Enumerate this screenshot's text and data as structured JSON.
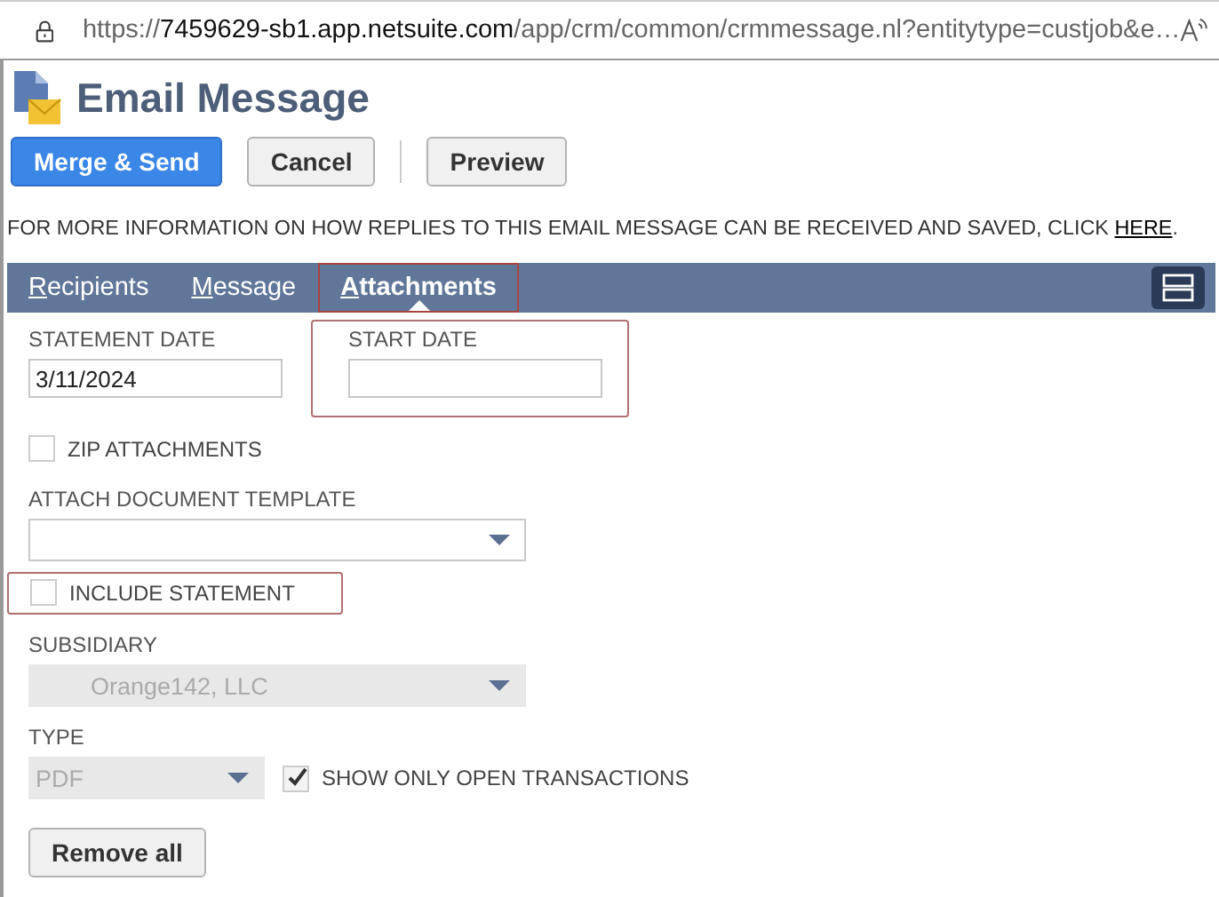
{
  "address_bar": {
    "scheme": "https://",
    "host": "7459629-sb1.app.netsuite.com",
    "path": "/app/crm/common/crmmessage.nl?entitytype=custjob&e…"
  },
  "title": "Email Message",
  "buttons": [
    {
      "label": "Merge & Send",
      "kind": "primary"
    },
    {
      "label": "Cancel",
      "kind": "secondary"
    },
    {
      "label": "Preview",
      "kind": "secondary"
    }
  ],
  "info": {
    "text": "FOR MORE INFORMATION ON HOW REPLIES TO THIS EMAIL MESSAGE CAN BE RECEIVED AND SAVED, CLICK ",
    "link": "HERE",
    "after": "."
  },
  "tabs": [
    {
      "label": "Recipients",
      "selected": false,
      "highlighted": false
    },
    {
      "label": "Message",
      "selected": false,
      "highlighted": false
    },
    {
      "label": "Attachments",
      "selected": true,
      "highlighted": true
    }
  ],
  "form": {
    "statement_date": {
      "label": "STATEMENT DATE",
      "value": "3/11/2024"
    },
    "start_date": {
      "label": "START DATE",
      "highlighted": true
    },
    "zip_attachments": {
      "label": "ZIP ATTACHMENTS",
      "checked": false
    },
    "document_template": {
      "label": "ATTACH DOCUMENT TEMPLATE",
      "disabled": false
    },
    "include_statement": {
      "label": "INCLUDE STATEMENT",
      "checked": false,
      "highlighted": true
    },
    "subsidiary": {
      "label": "SUBSIDIARY",
      "value": "Orange142, LLC",
      "disabled": true
    },
    "type": {
      "label": "TYPE",
      "value": "PDF",
      "disabled": true
    },
    "show_open": {
      "label": "SHOW ONLY OPEN TRANSACTIONS",
      "checked": true
    }
  },
  "remove_button": "Remove all"
}
